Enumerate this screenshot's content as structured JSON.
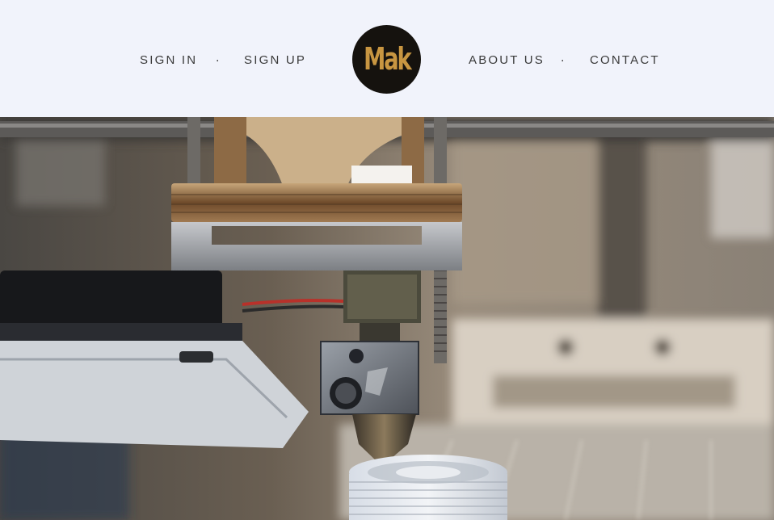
{
  "nav": {
    "sign_in": "SIGN IN",
    "separator_left": ".",
    "sign_up": "SIGN UP",
    "about_us": "ABOUT US",
    "separator_right": ".",
    "contact": "CONTACT"
  },
  "logo": {
    "text": "Mak"
  },
  "colors": {
    "header_bg": "#f1f3fb",
    "logo_bg": "#15120e",
    "logo_text": "#c89641",
    "nav_text": "#3a3a3a"
  },
  "hero": {
    "icon": "3d-printer-photo"
  }
}
